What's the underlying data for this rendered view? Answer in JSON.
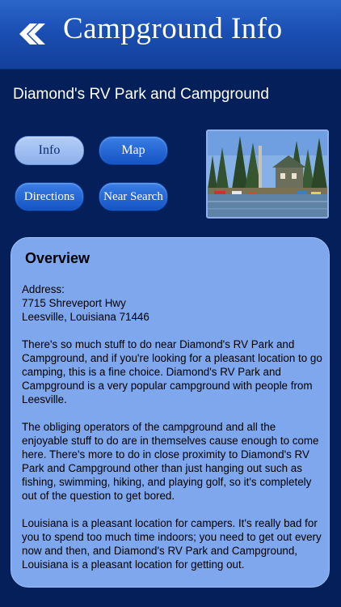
{
  "header": {
    "title": "Campground Info",
    "back_icon": "double-chevron-left-icon"
  },
  "park": {
    "name": "Diamond's RV Park and Campground"
  },
  "buttons": {
    "info": "Info",
    "map": "Map",
    "directions": "Directions",
    "near_search": "Near Search"
  },
  "overview": {
    "title": "Overview",
    "address_label": "Address:",
    "address_line1": "7715 Shreveport Hwy",
    "address_line2": "Leesville, Louisiana 71446",
    "paragraph1": "There's so much stuff to do near Diamond's RV Park and Campground, and if you're looking for a pleasant location to go camping, this is a fine choice. Diamond's RV Park and Campground is a very popular campground with people from Leesville.",
    "paragraph2": "The obliging operators of the campground and all the enjoyable stuff to do are in themselves cause enough to come here. There's more to do in close proximity to Diamond's RV Park and Campground other than just hanging out such as fishing, swimming, hiking, and playing golf, so it's completely out of the question to get bored.",
    "paragraph3": "Louisiana is a pleasant location for campers. It's really bad for you to spend too much time indoors; you need to get out every now and then, and Diamond's RV Park and Campground, Louisiana is a pleasant location for getting out."
  },
  "colors": {
    "background": "#041f5a",
    "header": "#1b4fb3",
    "card": "#7ea7ee",
    "button_light": "#9bbcf0",
    "button_dark": "#1f63d2"
  }
}
